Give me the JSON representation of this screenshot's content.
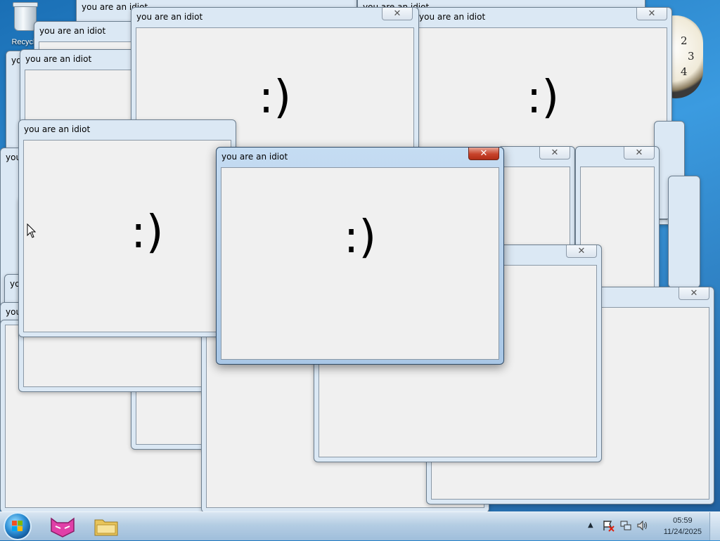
{
  "desktop": {
    "recycle_bin_label": "Recycle",
    "window_title": "you are an idiot",
    "window_content": ":)",
    "close_glyph": "✕",
    "clock_numbers": [
      "2",
      "3",
      "4"
    ]
  },
  "taskbar": {
    "time": "05:59",
    "date": "11/24/2025",
    "tray_icons": [
      "chevron-up-icon",
      "action-center-icon",
      "network-icon",
      "volume-icon"
    ]
  }
}
